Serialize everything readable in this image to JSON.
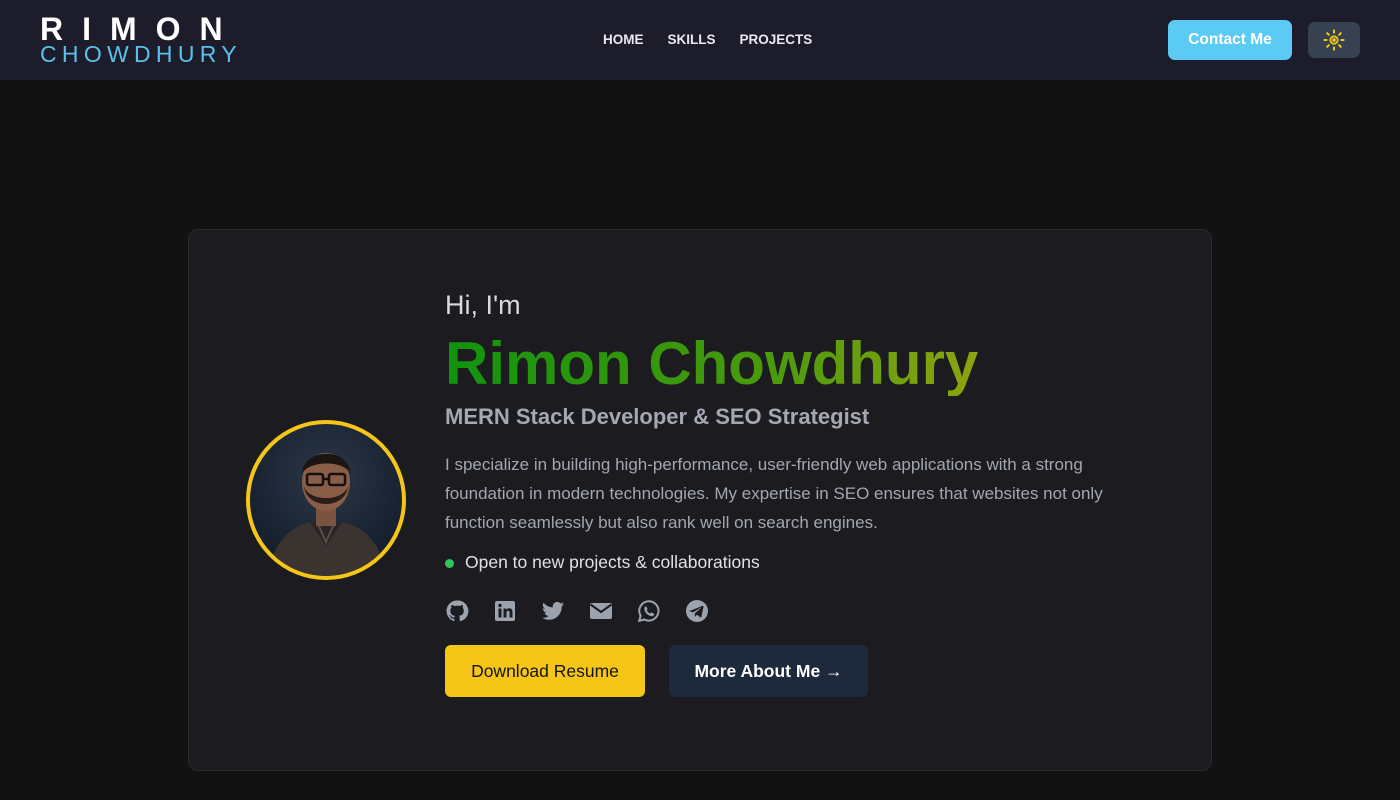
{
  "header": {
    "logo_first": "RIMON",
    "logo_last": "CHOWDHURY",
    "nav": [
      "HOME",
      "SKILLS",
      "PROJECTS"
    ],
    "contact_label": "Contact Me",
    "theme_icon": "sun-icon"
  },
  "hero": {
    "greeting": "Hi, I'm",
    "name": "Rimon Chowdhury",
    "role": "MERN Stack Developer & SEO Strategist",
    "bio": "I specialize in building high-performance, user-friendly web applications with a strong foundation in modern technologies. My expertise in SEO ensures that websites not only function seamlessly but also rank well on search engines.",
    "status": "Open to new projects & collaborations",
    "socials": [
      "github-icon",
      "linkedin-icon",
      "twitter-icon",
      "email-icon",
      "whatsapp-icon",
      "telegram-icon"
    ],
    "primary_button": "Download Resume",
    "secondary_button": "More About Me →"
  },
  "colors": {
    "accent": "#f5c518",
    "contact_button": "#5ccbf3",
    "logo_last": "#5bc0eb",
    "status_dot": "#2ec75a",
    "name_gradient_start": "#11930d",
    "name_gradient_end": "#d5c015"
  }
}
